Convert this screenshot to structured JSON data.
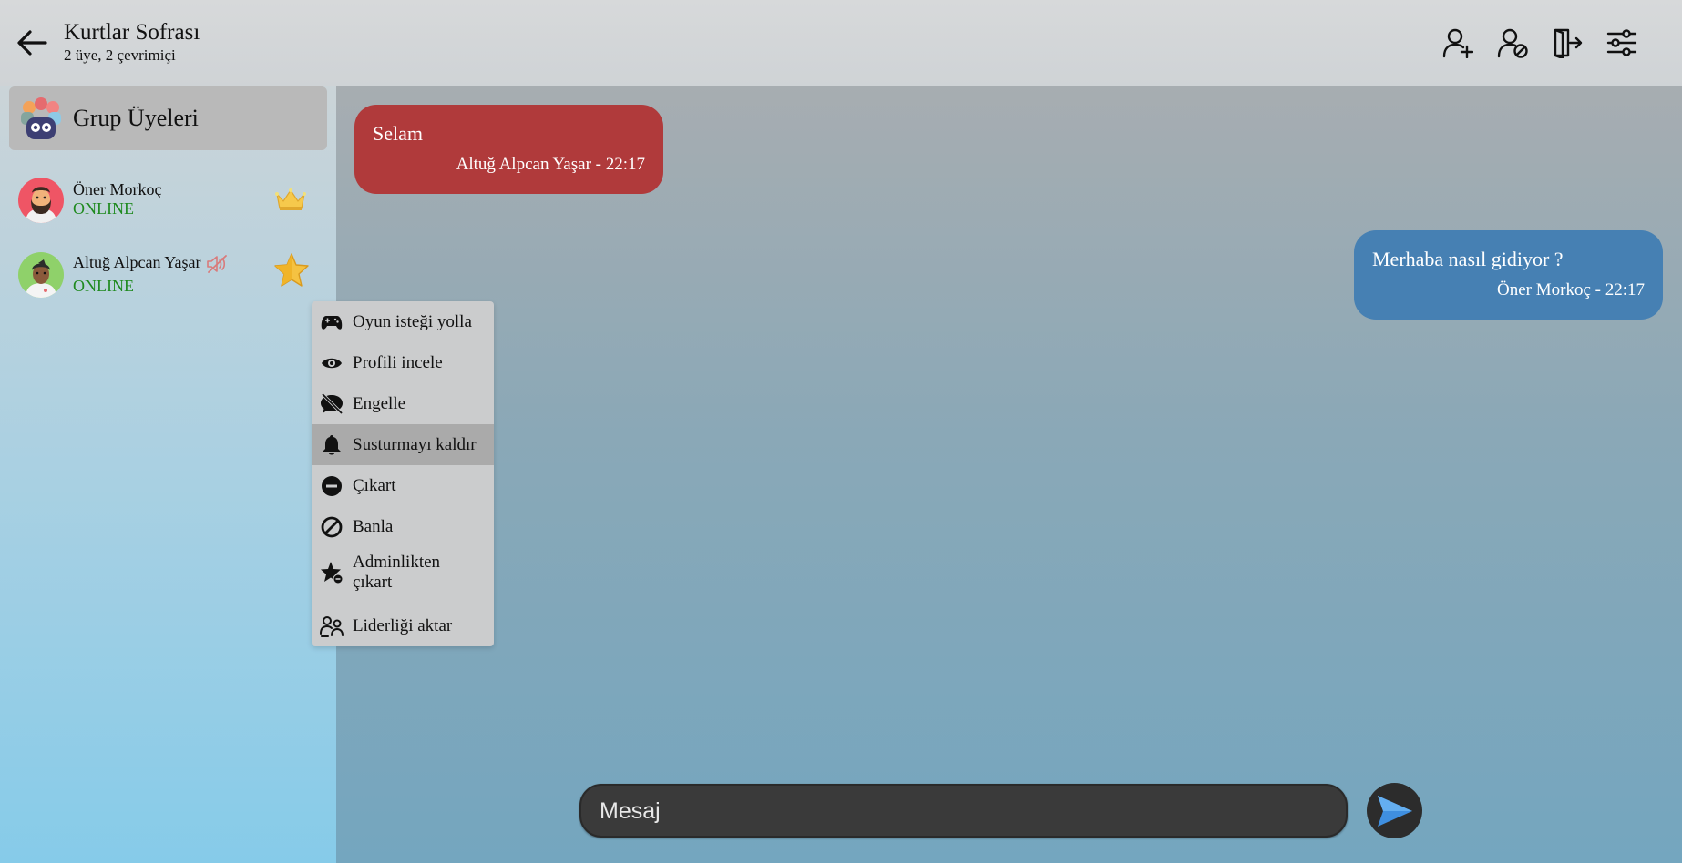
{
  "header": {
    "title": "Kurtlar Sofrası",
    "subtitle": "2 üye, 2 çevrimiçi",
    "icons": [
      "add-user-icon",
      "block-user-icon",
      "exit-door-icon",
      "settings-sliders-icon"
    ]
  },
  "sidebar": {
    "title": "Grup Üyeleri",
    "members": [
      {
        "name": "Öner Morkoç",
        "status": "ONLINE",
        "badge": "crown-icon",
        "muted": false
      },
      {
        "name": "Altuğ Alpcan Yaşar",
        "status": "ONLINE",
        "badge": "star-icon",
        "muted": true
      }
    ]
  },
  "messages": [
    {
      "text": "Selam",
      "meta": "Altuğ Alpcan Yaşar - 22:17",
      "side": "left",
      "color": "#b03a3b"
    },
    {
      "text": "Merhaba nasıl gidiyor ?",
      "meta": "Öner Morkoç - 22:17",
      "side": "right",
      "color": "#4680b3"
    }
  ],
  "context_menu": {
    "items": [
      {
        "label": "Oyun isteği yolla",
        "icon": "gamepad-icon"
      },
      {
        "label": "Profili incele",
        "icon": "eye-icon"
      },
      {
        "label": "Engelle",
        "icon": "chat-slash-icon"
      },
      {
        "label": "Susturmayı kaldır",
        "icon": "bell-icon",
        "active": true
      },
      {
        "label": "Çıkart",
        "icon": "minus-circle-icon"
      },
      {
        "label": "Banla",
        "icon": "ban-icon"
      },
      {
        "label": "Adminlikten çıkart",
        "icon": "star-minus-icon"
      },
      {
        "label": "Liderliği aktar",
        "icon": "transfer-users-icon"
      }
    ]
  },
  "composer": {
    "placeholder": "Mesaj"
  },
  "colors": {
    "online": "#1f8a1f",
    "accent_red": "#b03a3b",
    "accent_blue": "#4680b3"
  }
}
